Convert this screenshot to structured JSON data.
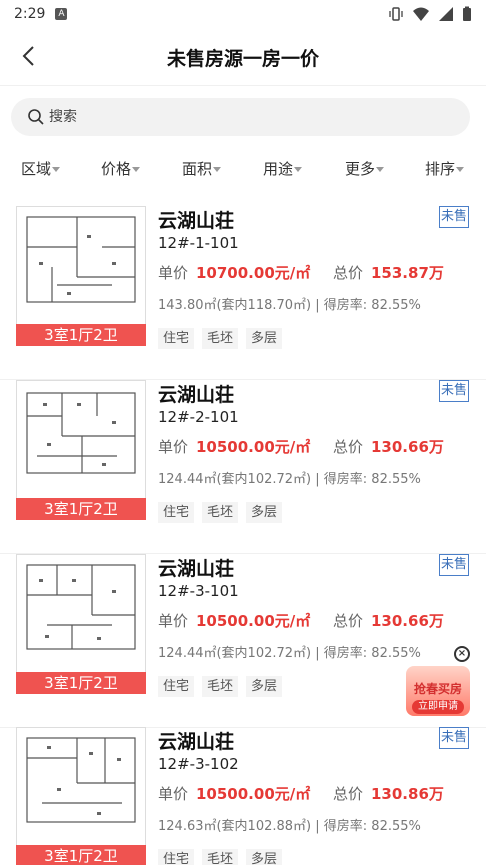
{
  "status_bar": {
    "time": "2:29",
    "app_indicator": "A"
  },
  "header": {
    "title": "未售房源一房一价",
    "back_icon": "back-arrow-icon"
  },
  "search": {
    "placeholder": "搜索"
  },
  "filters": [
    "区域",
    "价格",
    "面积",
    "用途",
    "更多",
    "排序"
  ],
  "price_labels": {
    "unit": "单价",
    "total": "总价"
  },
  "listings": [
    {
      "title": "云湖山荘",
      "code": "12#-1-101",
      "status": "未售",
      "unit_price": "10700.00元/㎡",
      "total_price": "153.87万",
      "area": "143.80㎡(套内118.70㎡)",
      "ratio": "得房率: 82.55%",
      "rooms": "3室1厅2卫",
      "tags": [
        "住宅",
        "毛坯",
        "多层"
      ]
    },
    {
      "title": "云湖山荘",
      "code": "12#-2-101",
      "status": "未售",
      "unit_price": "10500.00元/㎡",
      "total_price": "130.66万",
      "area": "124.44㎡(套内102.72㎡)",
      "ratio": "得房率: 82.55%",
      "rooms": "3室1厅2卫",
      "tags": [
        "住宅",
        "毛坯",
        "多层"
      ]
    },
    {
      "title": "云湖山荘",
      "code": "12#-3-101",
      "status": "未售",
      "unit_price": "10500.00元/㎡",
      "total_price": "130.66万",
      "area": "124.44㎡(套内102.72㎡)",
      "ratio": "得房率: 82.55%",
      "rooms": "3室1厅2卫",
      "tags": [
        "住宅",
        "毛坯",
        "多层"
      ]
    },
    {
      "title": "云湖山荘",
      "code": "12#-3-102",
      "status": "未售",
      "unit_price": "10500.00元/㎡",
      "total_price": "130.86万",
      "area": "124.63㎡(套内102.88㎡)",
      "ratio": "得房率: 82.55%",
      "rooms": "3室1厅2卫",
      "tags": [
        "住宅",
        "毛坯",
        "多层"
      ]
    }
  ],
  "promo": {
    "text": "抢春买房",
    "button": "立即申请",
    "close": "×"
  },
  "colors": {
    "accent_red": "#e53935",
    "badge_red": "#ef5350",
    "tag_blue": "#3a6fb8"
  }
}
